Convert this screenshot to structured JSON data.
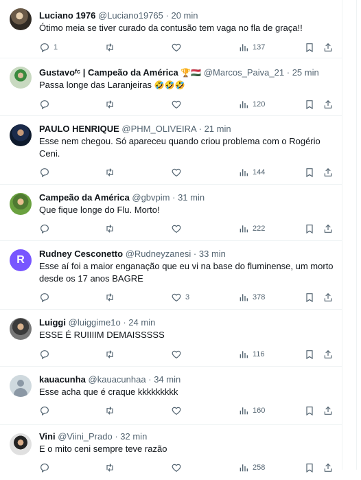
{
  "tweets": [
    {
      "name": "Luciano 1976",
      "handle": "@Luciano19765",
      "sep": "·",
      "time": "20 min",
      "text": "Ótimo meia se tiver curado da contusão tem vaga no fla de graça!!",
      "replies": "1",
      "retweets": "",
      "likes": "",
      "views": "137"
    },
    {
      "name": "Gustavoᶠᶜ | Campeão da América",
      "name_emoji": "🏆🇭🇺",
      "handle": "@Marcos_Paiva_21",
      "sep": "·",
      "time": "25 min",
      "text": "Passa longe das Laranjeiras",
      "text_emoji": "🤣🤣🤣",
      "replies": "",
      "retweets": "",
      "likes": "",
      "views": "120"
    },
    {
      "name": "PAULO HENRIQUE",
      "handle": "@PHM_OLIVEIRA",
      "sep": "·",
      "time": "21 min",
      "text": "Esse nem chegou. Só apareceu quando criou problema com o Rogério Ceni.",
      "replies": "",
      "retweets": "",
      "likes": "",
      "views": "144"
    },
    {
      "name": "Campeão da América",
      "handle": "@gbvpim",
      "sep": "·",
      "time": "31 min",
      "text": "Que fique longe do Flu. Morto!",
      "replies": "",
      "retweets": "",
      "likes": "",
      "views": "222"
    },
    {
      "name": "Rudney Cesconetto",
      "handle": "@Rudneyzanesi",
      "sep": "·",
      "time": "33 min",
      "avatar_letter": "R",
      "text": "Esse aí foi a maior enganação que eu vi na base do fluminense, um morto desde os 17 anos BAGRE",
      "replies": "",
      "retweets": "",
      "likes": "3",
      "views": "378"
    },
    {
      "name": "Luiggi",
      "handle": "@luiggime1o",
      "sep": "·",
      "time": "24 min",
      "text": "ESSE É RUIIIIM DEMAISSSSS",
      "replies": "",
      "retweets": "",
      "likes": "",
      "views": "116"
    },
    {
      "name": "kauacunha",
      "handle": "@kauacunhaa",
      "sep": "·",
      "time": "34 min",
      "text": "Esse acha que é craque kkkkkkkkk",
      "replies": "",
      "retweets": "",
      "likes": "",
      "views": "160"
    },
    {
      "name": "Vini",
      "handle": "@Viini_Prado",
      "sep": "·",
      "time": "32 min",
      "text": "E o mito ceni sempre teve razão",
      "replies": "",
      "retweets": "",
      "likes": "",
      "views": "258"
    }
  ],
  "icons": {
    "reply": "reply-icon",
    "retweet": "retweet-icon",
    "like": "heart-icon",
    "views": "views-icon",
    "bookmark": "bookmark-icon",
    "share": "share-icon"
  },
  "colors": {
    "text": "#0f1419",
    "secondary": "#536471",
    "border": "#eff3f4",
    "avatar_default": "#7856ff"
  }
}
